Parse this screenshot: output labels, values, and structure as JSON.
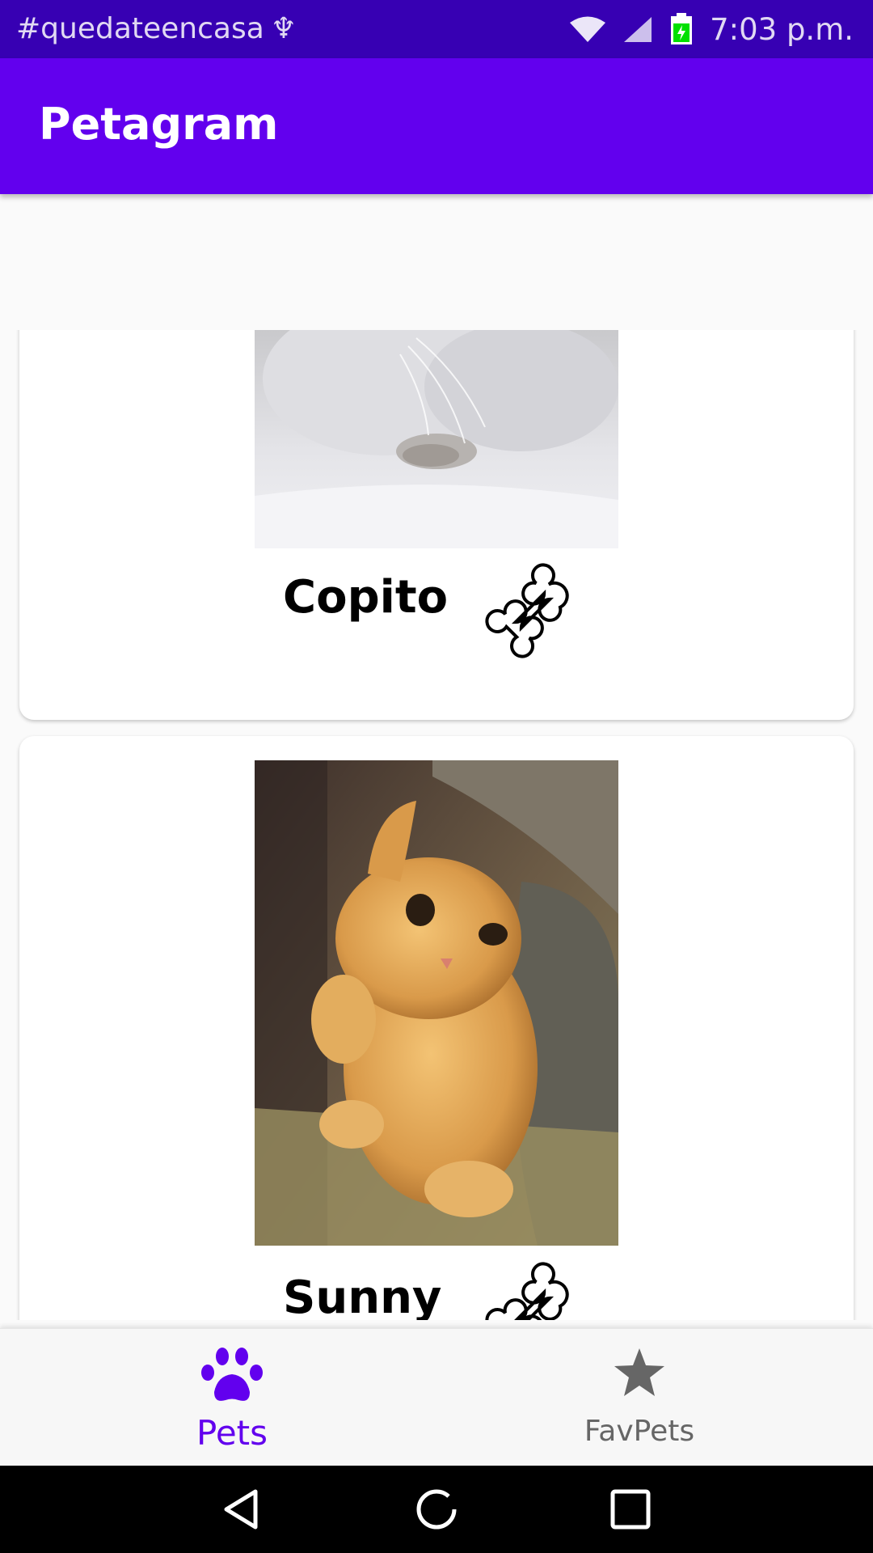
{
  "status_bar": {
    "hashtag": "#quedateencasa",
    "time": "7:03 p.m.",
    "icons": [
      "usb-icon",
      "wifi-icon",
      "cell-signal-icon",
      "battery-charging-icon"
    ]
  },
  "app_bar": {
    "title": "Petagram"
  },
  "pets": [
    {
      "name": "Copito",
      "photo": "white-cat-photo",
      "action_icon": "bone-icon"
    },
    {
      "name": "Sunny",
      "photo": "orange-kitten-photo",
      "action_icon": "bone-icon"
    }
  ],
  "bottom_nav": {
    "items": [
      {
        "label": "Pets",
        "icon": "paw-icon",
        "selected": true
      },
      {
        "label": "FavPets",
        "icon": "star-icon",
        "selected": false
      }
    ]
  },
  "system_nav": {
    "buttons": [
      "back-icon",
      "home-icon",
      "recents-icon"
    ]
  },
  "colors": {
    "status_bar": "#3700b3",
    "app_bar": "#6200ee",
    "nav_selected": "#6200ee",
    "nav_unselected": "#666666",
    "background": "#fafafa"
  }
}
